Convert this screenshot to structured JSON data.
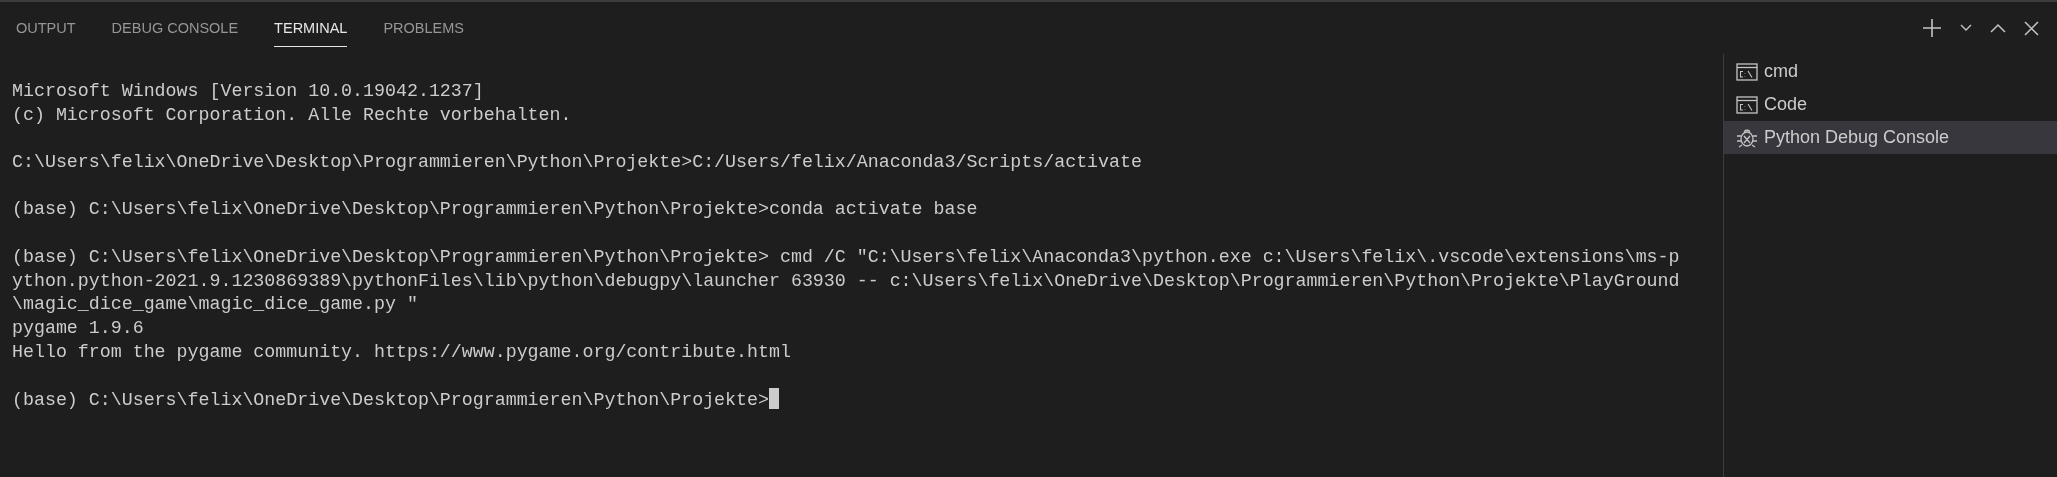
{
  "panel_tabs": [
    {
      "label": "OUTPUT",
      "selected": false
    },
    {
      "label": "DEBUG CONSOLE",
      "selected": false
    },
    {
      "label": "TERMINAL",
      "selected": true
    },
    {
      "label": "PROBLEMS",
      "selected": false
    }
  ],
  "toolbar": [
    {
      "kind": "add"
    },
    {
      "kind": "dropdown"
    },
    {
      "kind": "maximize"
    },
    {
      "kind": "close"
    }
  ],
  "terminal_lines": [
    {
      "text": "Microsoft Windows [Version 10.0.19042.1237]",
      "gap_before": false
    },
    {
      "text": "(c) Microsoft Corporation. Alle Rechte vorbehalten.",
      "gap_before": false
    },
    {
      "text": "C:\\Users\\felix\\OneDrive\\Desktop\\Programmieren\\Python\\Projekte>C:/Users/felix/Anaconda3/Scripts/activate",
      "gap_before": true
    },
    {
      "text": "(base) C:\\Users\\felix\\OneDrive\\Desktop\\Programmieren\\Python\\Projekte>conda activate base",
      "gap_before": true
    },
    {
      "text": "(base) C:\\Users\\felix\\OneDrive\\Desktop\\Programmieren\\Python\\Projekte> cmd /C \"C:\\Users\\felix\\Anaconda3\\python.exe c:\\Users\\felix\\.vscode\\extensions\\ms-p",
      "gap_before": true
    },
    {
      "text": "ython.python-2021.9.1230869389\\pythonFiles\\lib\\python\\debugpy\\launcher 63930 -- c:\\Users\\felix\\OneDrive\\Desktop\\Programmieren\\Python\\Projekte\\PlayGround",
      "gap_before": false
    },
    {
      "text": "\\magic_dice_game\\magic_dice_game.py \"",
      "gap_before": false
    },
    {
      "text": "pygame 1.9.6",
      "gap_before": false
    },
    {
      "text": "Hello from the pygame community. https://www.pygame.org/contribute.html",
      "gap_before": false
    },
    {
      "text": "(base) C:\\Users\\felix\\OneDrive\\Desktop\\Programmieren\\Python\\Projekte>",
      "gap_before": true,
      "cursor": true
    }
  ],
  "terminals": [
    {
      "kind": "cmd",
      "label": "cmd",
      "selected": false
    },
    {
      "kind": "cmd",
      "label": "Code",
      "selected": false
    },
    {
      "kind": "debug",
      "label": "Python Debug Console",
      "selected": true
    }
  ]
}
